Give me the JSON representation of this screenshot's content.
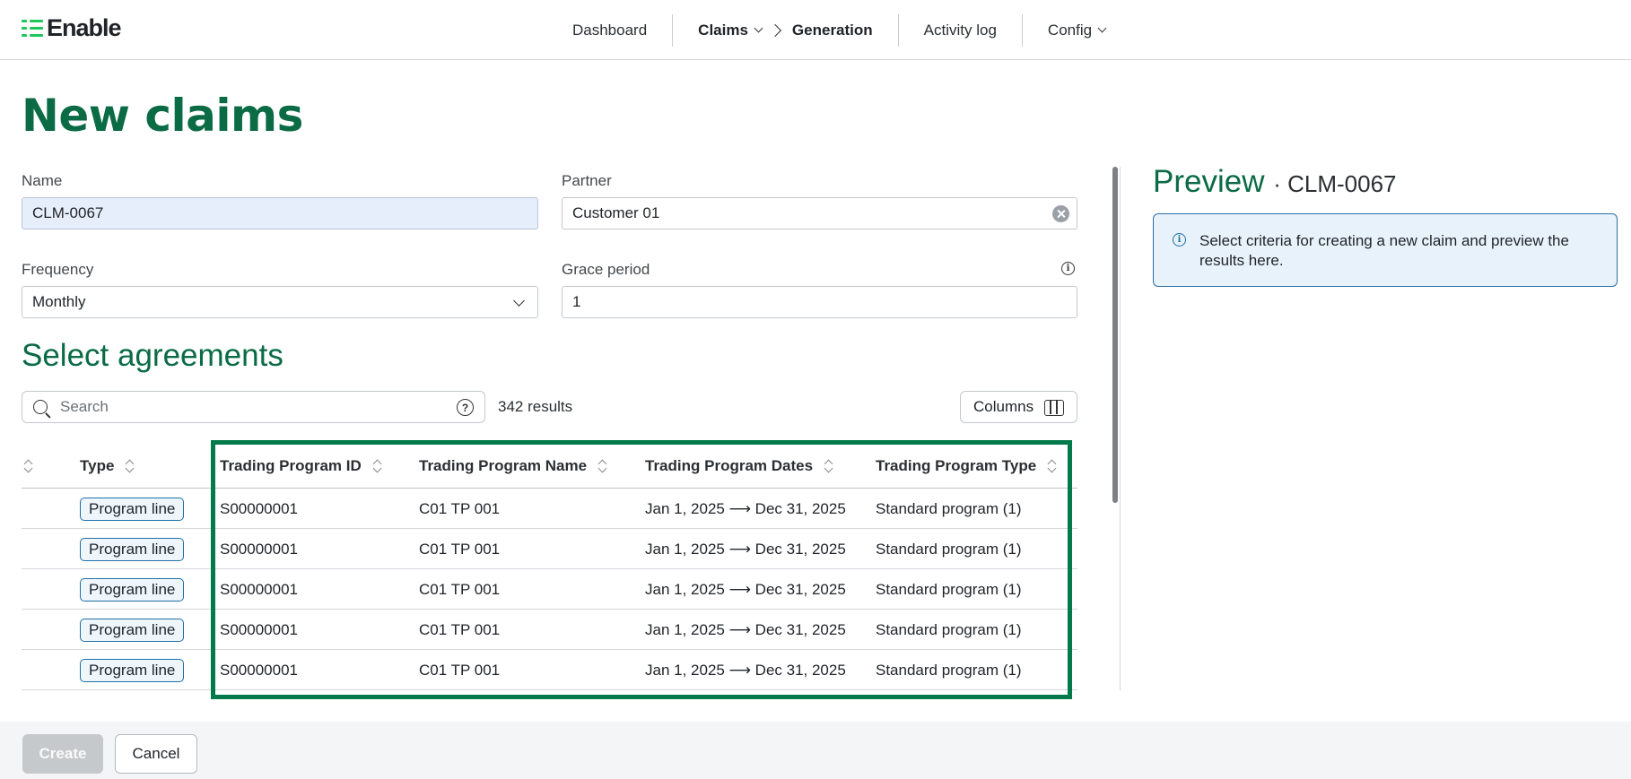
{
  "app": {
    "logo_text": "Enable"
  },
  "nav": {
    "dashboard": "Dashboard",
    "claims": "Claims",
    "generation": "Generation",
    "activity_log": "Activity log",
    "config": "Config"
  },
  "page": {
    "title": "New claims"
  },
  "form": {
    "name_label": "Name",
    "name_value": "CLM-0067",
    "partner_label": "Partner",
    "partner_value": "Customer 01",
    "frequency_label": "Frequency",
    "frequency_value": "Monthly",
    "grace_label": "Grace period",
    "grace_value": "1"
  },
  "agreements": {
    "title": "Select agreements",
    "search_placeholder": "Search",
    "results": "342 results",
    "columns_label": "Columns",
    "headers": {
      "type": "Type",
      "tp_id": "Trading Program ID",
      "tp_name": "Trading Program Name",
      "tp_dates": "Trading Program Dates",
      "tp_type": "Trading Program Type"
    },
    "rows": [
      {
        "type": "Program line",
        "tp_id": "S00000001",
        "tp_name": "C01 TP 001",
        "tp_dates": "Jan 1, 2025 ⟶ Dec 31, 2025",
        "tp_type": "Standard program (1)"
      },
      {
        "type": "Program line",
        "tp_id": "S00000001",
        "tp_name": "C01 TP 001",
        "tp_dates": "Jan 1, 2025 ⟶ Dec 31, 2025",
        "tp_type": "Standard program (1)"
      },
      {
        "type": "Program line",
        "tp_id": "S00000001",
        "tp_name": "C01 TP 001",
        "tp_dates": "Jan 1, 2025 ⟶ Dec 31, 2025",
        "tp_type": "Standard program (1)"
      },
      {
        "type": "Program line",
        "tp_id": "S00000001",
        "tp_name": "C01 TP 001",
        "tp_dates": "Jan 1, 2025 ⟶ Dec 31, 2025",
        "tp_type": "Standard program (1)"
      },
      {
        "type": "Program line",
        "tp_id": "S00000001",
        "tp_name": "C01 TP 001",
        "tp_dates": "Jan 1, 2025 ⟶ Dec 31, 2025",
        "tp_type": "Standard program (1)"
      }
    ]
  },
  "preview": {
    "title": "Preview",
    "subtitle": "· CLM-0067",
    "message": "Select criteria for creating a new claim and preview the results here."
  },
  "footer": {
    "create_label": "Create",
    "cancel_label": "Cancel"
  },
  "colors": {
    "brand_green": "#0a6b45",
    "highlight": "#007a4a",
    "info_blue": "#1f6fa8"
  }
}
